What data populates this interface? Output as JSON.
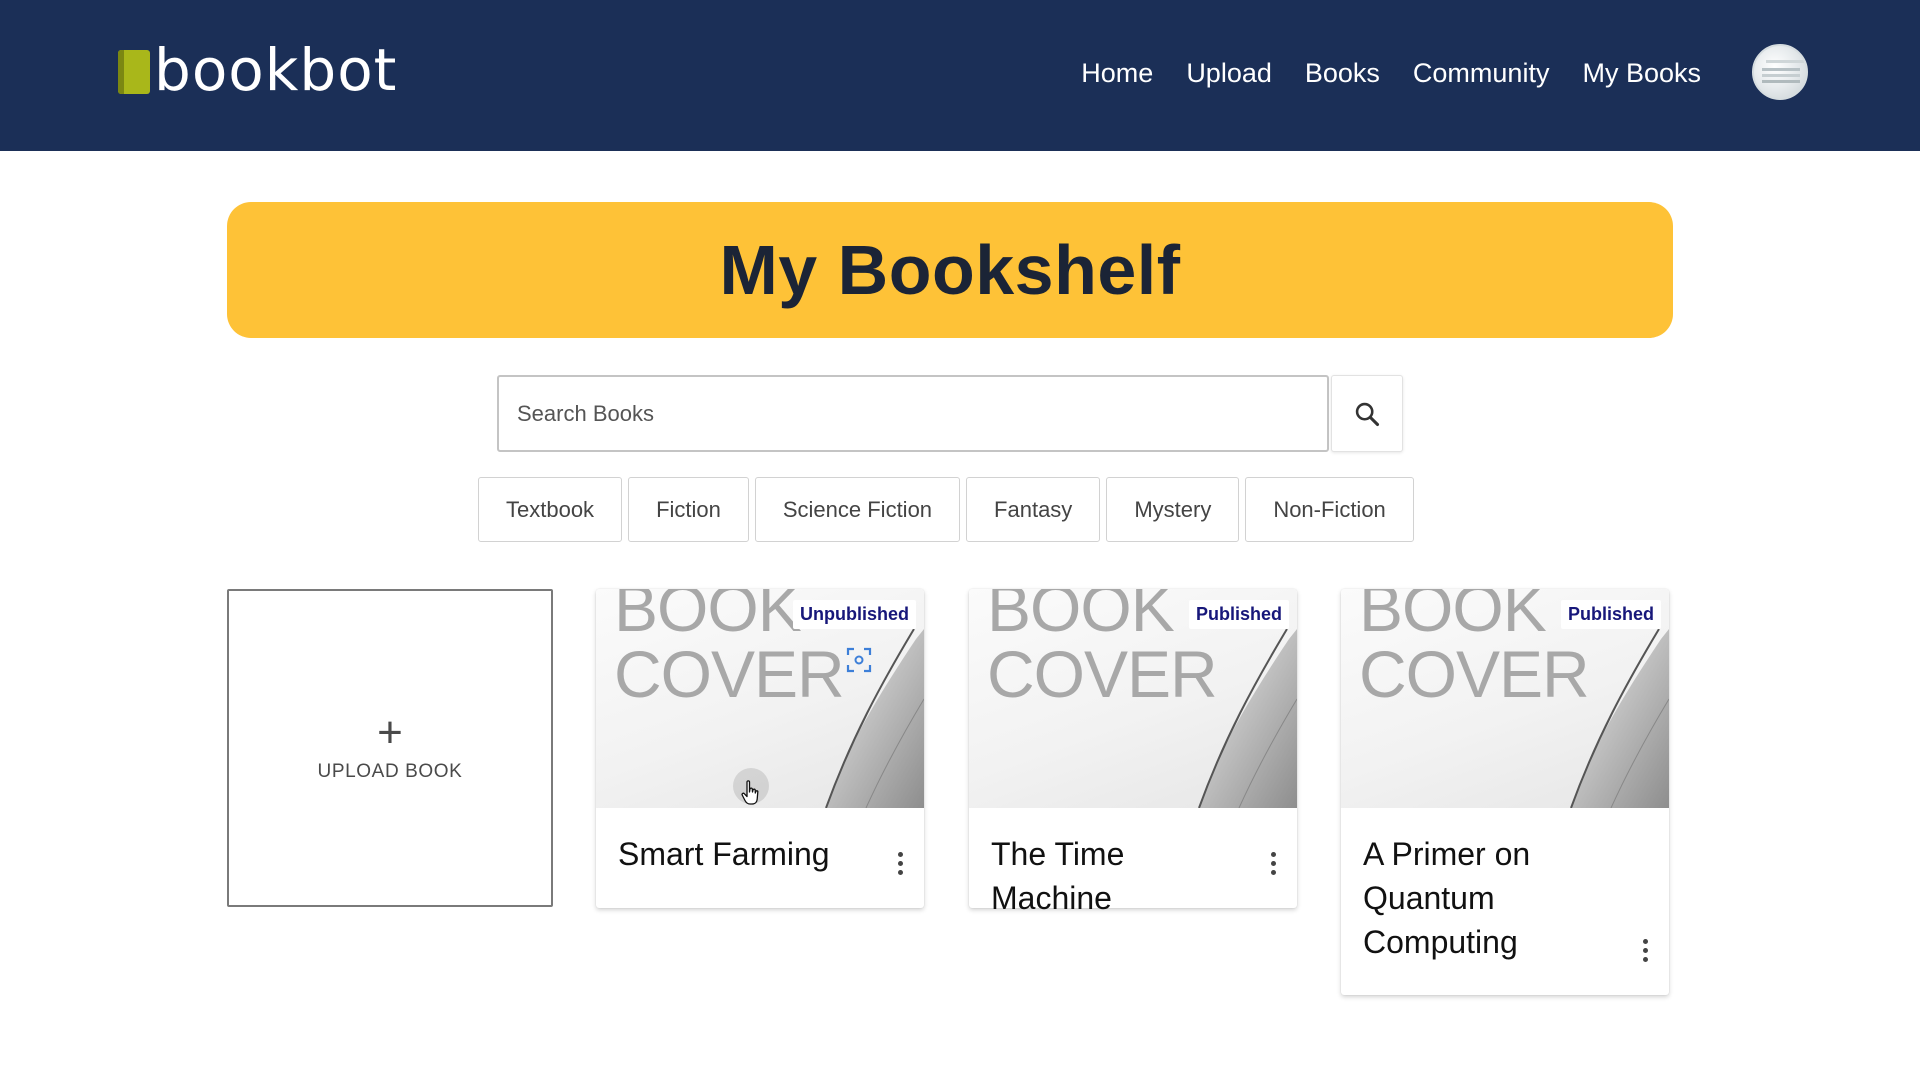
{
  "brand": {
    "name": "bookbot",
    "accent_color": "#1b2f57",
    "logo_color": "#a9b71a"
  },
  "nav": {
    "links": [
      "Home",
      "Upload",
      "Books",
      "Community",
      "My Books"
    ]
  },
  "page": {
    "title": "My Bookshelf",
    "banner_color": "#fec237"
  },
  "search": {
    "placeholder": "Search Books",
    "value": ""
  },
  "genres": [
    "Textbook",
    "Fiction",
    "Science Fiction",
    "Fantasy",
    "Mystery",
    "Non-Fiction"
  ],
  "upload_card": {
    "label": "UPLOAD BOOK"
  },
  "books": [
    {
      "title": "Smart Farming",
      "status": "Unpublished",
      "cover_line1": "BOOK",
      "cover_line2": "COVER"
    },
    {
      "title": "The Time Machine",
      "status": "Published",
      "cover_line1": "BOOK",
      "cover_line2": "COVER"
    },
    {
      "title": "A Primer on Quantum Computing",
      "status": "Published",
      "cover_line1": "BOOK",
      "cover_line2": "COVER"
    }
  ],
  "icons": {
    "search": "search-icon",
    "more": "more-vert-icon",
    "add": "plus-icon",
    "scan": "scan-icon",
    "cursor": "hand-cursor-icon"
  },
  "status_color": "#17177a"
}
